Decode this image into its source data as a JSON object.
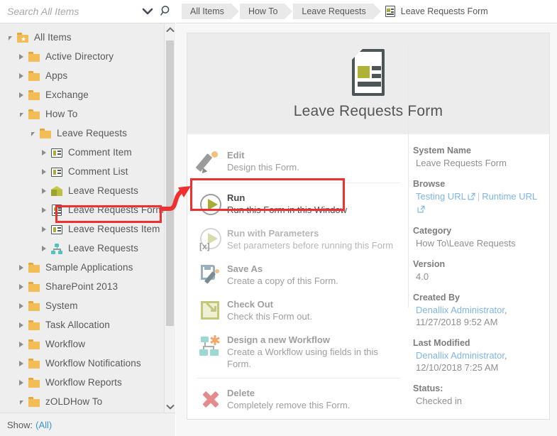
{
  "search": {
    "placeholder": "Search All Items",
    "value": ""
  },
  "tree": {
    "show_label": "Show:",
    "show_value": "(All)",
    "items": [
      {
        "label": "All Items",
        "indent": 0,
        "icon": "star-folder-icon",
        "state": "open",
        "selected": false
      },
      {
        "label": "Active Directory",
        "indent": 1,
        "icon": "folder-icon",
        "state": "closed",
        "selected": false
      },
      {
        "label": "Apps",
        "indent": 1,
        "icon": "folder-icon",
        "state": "closed",
        "selected": false
      },
      {
        "label": "Exchange",
        "indent": 1,
        "icon": "folder-icon",
        "state": "closed",
        "selected": false
      },
      {
        "label": "How To",
        "indent": 1,
        "icon": "folder-icon",
        "state": "open",
        "selected": false
      },
      {
        "label": "Leave Requests",
        "indent": 2,
        "icon": "folder-icon",
        "state": "open",
        "selected": false
      },
      {
        "label": "Comment Item",
        "indent": 3,
        "icon": "item-icon",
        "state": "closed",
        "selected": false
      },
      {
        "label": "Comment List",
        "indent": 3,
        "icon": "item-icon",
        "state": "closed",
        "selected": false
      },
      {
        "label": "Leave Requests",
        "indent": 3,
        "icon": "smartobject-icon",
        "state": "closed",
        "selected": false
      },
      {
        "label": "Leave Requests Form",
        "indent": 3,
        "icon": "form-icon",
        "state": "closed",
        "selected": true
      },
      {
        "label": "Leave Requests Item",
        "indent": 3,
        "icon": "item-icon",
        "state": "closed",
        "selected": false
      },
      {
        "label": "Leave Requests",
        "indent": 3,
        "icon": "workflow-icon",
        "state": "closed",
        "selected": false
      },
      {
        "label": "Sample Applications",
        "indent": 1,
        "icon": "folder-icon",
        "state": "closed",
        "selected": false
      },
      {
        "label": "SharePoint 2013",
        "indent": 1,
        "icon": "folder-icon",
        "state": "closed",
        "selected": false
      },
      {
        "label": "System",
        "indent": 1,
        "icon": "folder-icon",
        "state": "closed",
        "selected": false
      },
      {
        "label": "Task Allocation",
        "indent": 1,
        "icon": "folder-icon",
        "state": "closed",
        "selected": false
      },
      {
        "label": "Workflow",
        "indent": 1,
        "icon": "folder-icon",
        "state": "closed",
        "selected": false
      },
      {
        "label": "Workflow Notifications",
        "indent": 1,
        "icon": "folder-icon",
        "state": "closed",
        "selected": false
      },
      {
        "label": "Workflow Reports",
        "indent": 1,
        "icon": "folder-icon",
        "state": "closed",
        "selected": false
      },
      {
        "label": "zOLDHow To",
        "indent": 1,
        "icon": "folder-icon",
        "state": "open",
        "selected": false
      }
    ]
  },
  "breadcrumb": {
    "crumbs": [
      "All Items",
      "How To",
      "Leave Requests"
    ],
    "current": "Leave Requests Form",
    "current_icon": "form-icon"
  },
  "card": {
    "title": "Leave Requests Form",
    "icon": "form-icon",
    "actions": [
      {
        "title": "Edit",
        "desc": "Design this Form.",
        "icon": "pencil-icon",
        "state": "dim"
      },
      {
        "title": "Run",
        "desc": "Run this Form in this Window",
        "icon": "play-icon",
        "state": "enabled"
      },
      {
        "title": "Run with Parameters",
        "desc": "Set parameters before running this Form",
        "icon": "play-params-icon",
        "state": "disabled"
      },
      {
        "title": "Save As",
        "desc": "Create a copy of this Form.",
        "icon": "save-as-icon",
        "state": "dim"
      },
      {
        "title": "Check Out",
        "desc": "Check this Form out.",
        "icon": "check-out-icon",
        "state": "dim"
      },
      {
        "title": "Design a new Workflow",
        "desc": "Create a Workflow using fields in this Form.",
        "icon": "new-workflow-icon",
        "state": "dim"
      },
      {
        "title": "Delete",
        "desc": "Completely remove this Form.",
        "icon": "delete-icon",
        "state": "dim"
      }
    ],
    "details": {
      "system_name_label": "System Name",
      "system_name_value": "Leave Requests Form",
      "browse_label": "Browse",
      "browse_testing_url": "Testing URL",
      "browse_separator": "|",
      "browse_runtime_url": "Runtime URL",
      "category_label": "Category",
      "category_value": "How To\\Leave Requests",
      "version_label": "Version",
      "version_value": "4.0",
      "created_by_label": "Created By",
      "created_by_user": "Denallix Administrator",
      "created_by_comma": ",",
      "created_by_date": "11/27/2018 9:52 AM",
      "last_modified_label": "Last Modified",
      "last_modified_user": "Denallix Administrator",
      "last_modified_comma": ",",
      "last_modified_date": "12/10/2018 7:25 AM",
      "status_label": "Status:",
      "status_value": "Checked in"
    }
  },
  "colors": {
    "accent_red": "#f22f2f",
    "link_blue": "#7cb6e8",
    "folder_yellow": "#f2bd55",
    "olive": "#a6ac34",
    "teal": "#4fc3bd"
  }
}
